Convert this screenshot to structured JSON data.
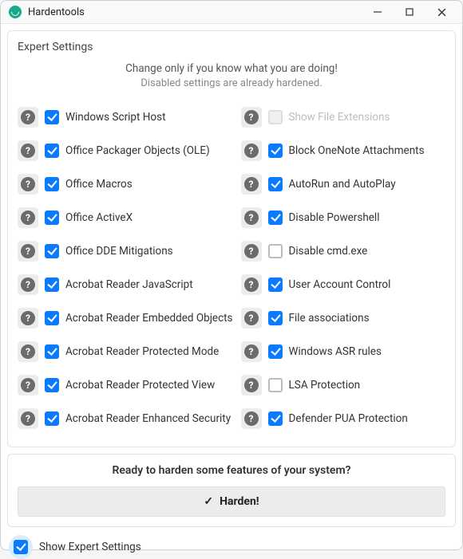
{
  "window": {
    "title": "Hardentools"
  },
  "panel": {
    "heading": "Expert Settings",
    "subtitle_line1": "Change only if you know what you are doing!",
    "subtitle_line2": "Disabled settings are already hardened."
  },
  "settings": {
    "left": [
      {
        "label": "Windows Script Host",
        "checked": true,
        "disabled": false
      },
      {
        "label": "Office Packager Objects (OLE)",
        "checked": true,
        "disabled": false
      },
      {
        "label": "Office Macros",
        "checked": true,
        "disabled": false
      },
      {
        "label": "Office ActiveX",
        "checked": true,
        "disabled": false
      },
      {
        "label": "Office DDE Mitigations",
        "checked": true,
        "disabled": false
      },
      {
        "label": "Acrobat Reader JavaScript",
        "checked": true,
        "disabled": false
      },
      {
        "label": "Acrobat Reader Embedded Objects",
        "checked": true,
        "disabled": false
      },
      {
        "label": "Acrobat Reader Protected Mode",
        "checked": true,
        "disabled": false
      },
      {
        "label": "Acrobat Reader Protected View",
        "checked": true,
        "disabled": false
      },
      {
        "label": "Acrobat Reader Enhanced Security",
        "checked": true,
        "disabled": false
      }
    ],
    "right": [
      {
        "label": "Show File Extensions",
        "checked": false,
        "disabled": true
      },
      {
        "label": "Block OneNote Attachments",
        "checked": true,
        "disabled": false
      },
      {
        "label": "AutoRun and AutoPlay",
        "checked": true,
        "disabled": false
      },
      {
        "label": "Disable Powershell",
        "checked": true,
        "disabled": false
      },
      {
        "label": "Disable cmd.exe",
        "checked": false,
        "disabled": false
      },
      {
        "label": "User Account Control",
        "checked": true,
        "disabled": false
      },
      {
        "label": "File associations",
        "checked": true,
        "disabled": false
      },
      {
        "label": "Windows ASR rules",
        "checked": true,
        "disabled": false
      },
      {
        "label": "LSA Protection",
        "checked": false,
        "disabled": false
      },
      {
        "label": "Defender PUA Protection",
        "checked": true,
        "disabled": false
      }
    ]
  },
  "footer": {
    "prompt": "Ready to harden some features of your system?",
    "button_label": "Harden!"
  },
  "expert_toggle": {
    "label": "Show Expert Settings",
    "checked": true
  },
  "help_glyph": "?"
}
